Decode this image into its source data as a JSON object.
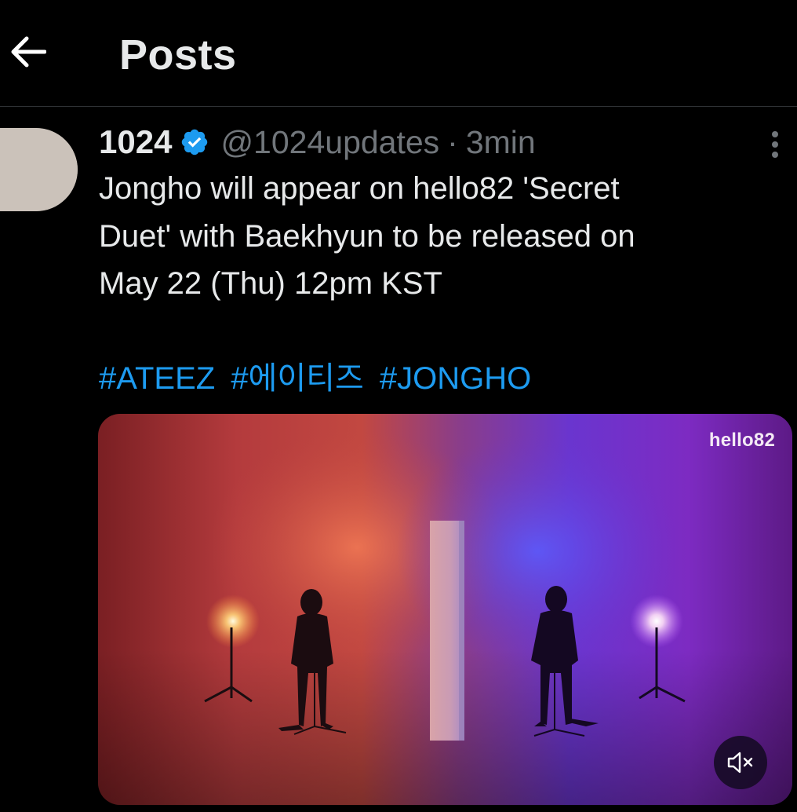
{
  "header": {
    "title": "Posts",
    "back_icon": "arrow-left-icon"
  },
  "post": {
    "author": {
      "display_name": "1024",
      "handle": "@1024updates",
      "verified": true,
      "verified_icon": "verified-badge-icon",
      "avatar_color": "#cbc2ba"
    },
    "separator": "·",
    "time": "3min",
    "more_icon": "more-vertical-icon",
    "text_lines": [
      "Jongho will appear on hello82 'Secret",
      "Duet' with Baekhyun to be released on",
      "May 22 (Thu) 12pm KST"
    ],
    "hashtags": [
      "#ATEEZ",
      "#에이티즈",
      "#JONGHO"
    ],
    "media": {
      "type": "video",
      "watermark": "hello82",
      "mute_icon": "volume-muted-icon"
    }
  },
  "colors": {
    "background": "#000000",
    "text_primary": "#e7e9ea",
    "text_secondary": "#71767b",
    "link": "#1d9bf0",
    "divider": "#2f3336",
    "verified": "#1d9bf0"
  }
}
